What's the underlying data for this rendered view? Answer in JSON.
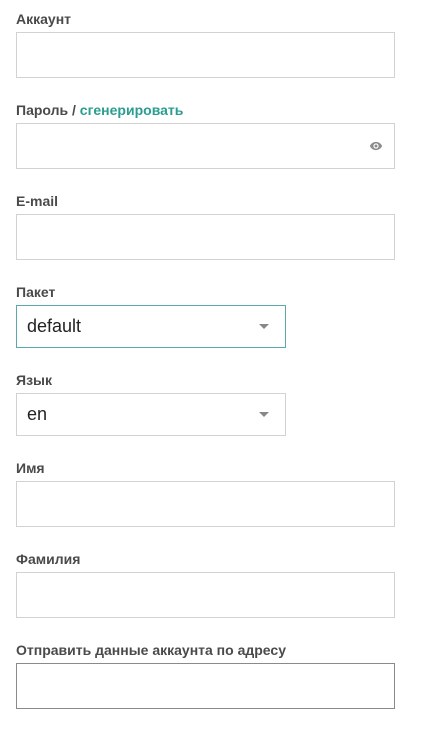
{
  "fields": {
    "account": {
      "label": "Аккаунт",
      "value": ""
    },
    "password": {
      "label": "Пароль",
      "separator": " / ",
      "generate_link": "сгенерировать",
      "value": "",
      "icon": "eye-icon"
    },
    "email": {
      "label": "E-mail",
      "value": ""
    },
    "package": {
      "label": "Пакет",
      "selected": "default"
    },
    "language": {
      "label": "Язык",
      "selected": "en"
    },
    "first_name": {
      "label": "Имя",
      "value": ""
    },
    "last_name": {
      "label": "Фамилия",
      "value": ""
    },
    "send_to": {
      "label": "Отправить данные аккаунта по адресу",
      "value": ""
    }
  },
  "colors": {
    "accent": "#2a9d8f",
    "label": "#4a4a4a",
    "border": "#d2d2d2",
    "focus_border": "#5aa9ad"
  }
}
